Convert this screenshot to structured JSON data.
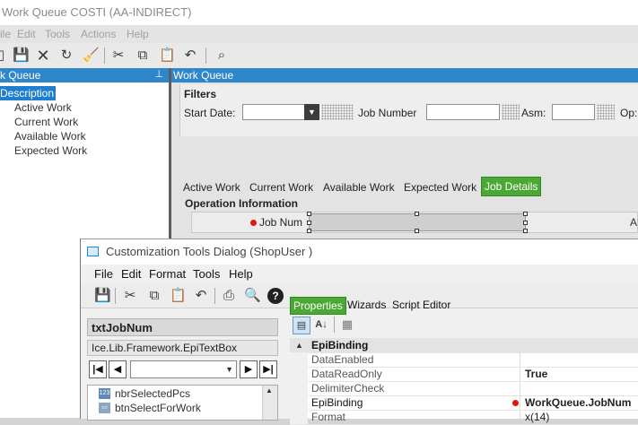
{
  "window": {
    "title": "Work Queue COSTI (AA-INDIRECT)",
    "menu": [
      "ile",
      "Edit",
      "Tools",
      "Actions",
      "Help"
    ]
  },
  "tree": {
    "header": "k Queue",
    "root": "Description",
    "items": [
      "Active Work",
      "Current Work",
      "Available Work",
      "Expected Work"
    ]
  },
  "work_queue": {
    "header": "Work Queue",
    "filters_label": "Filters",
    "start_date_label": "Start Date:",
    "start_date_value": "",
    "job_number_label": "Job Number",
    "asm_label": "Asm:",
    "op_label": "Op:",
    "tabs": [
      "Active Work",
      "Current Work",
      "Available Work",
      "Expected Work",
      "Job Details"
    ],
    "op_info_title": "Operation Information",
    "job_num_label": "Job Num",
    "right_cut_label": "A"
  },
  "dialog": {
    "title": "Customization Tools Dialog  (ShopUser )",
    "menu": [
      "File",
      "Edit",
      "Format",
      "Tools",
      "Help"
    ],
    "control_name": "txtJobNum",
    "control_type": "Ice.Lib.Framework.EpiTextBox",
    "controls_list": [
      {
        "icon": "numeric-box-icon",
        "label": "nbrSelectedPcs"
      },
      {
        "icon": "button-icon",
        "label": "btnSelectForWork"
      }
    ],
    "tabs": [
      "Properties",
      "Wizards",
      "Script Editor"
    ],
    "property_category": "EpiBinding",
    "properties": [
      {
        "name": "DataEnabled",
        "value": ""
      },
      {
        "name": "DataReadOnly",
        "value": "True"
      },
      {
        "name": "DelimiterCheck",
        "value": ""
      },
      {
        "name": "EpiBinding",
        "value": "WorkQueue.JobNum"
      },
      {
        "name": "Format",
        "value": "x(14)"
      }
    ]
  },
  "colors": {
    "accent_blue": "#2f86c8",
    "selected_tab_green": "#4ca834",
    "required_red": "#e01616"
  }
}
